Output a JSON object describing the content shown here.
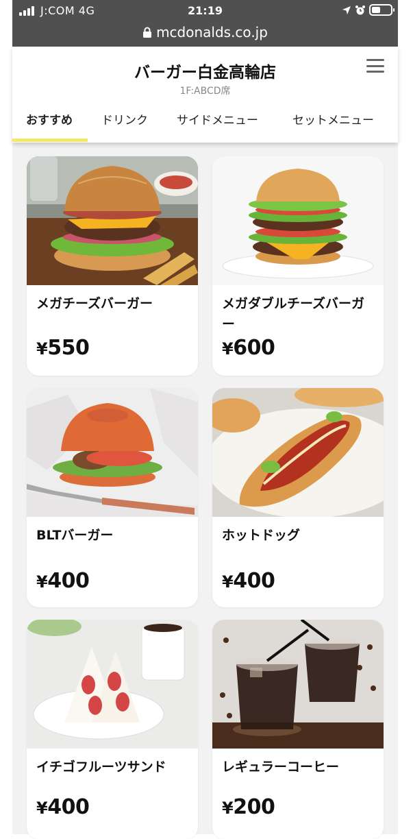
{
  "status_bar": {
    "carrier": "J:COM  4G",
    "time": "21:19"
  },
  "browser": {
    "url": "mcdonalds.co.jp"
  },
  "header": {
    "shop_name": "バーガー白金高輪店",
    "seat": "1F:ABCD席",
    "menu_icon": "hamburger-menu-icon"
  },
  "tabs": [
    {
      "label": "おすすめ",
      "active": true
    },
    {
      "label": "ドリンク",
      "active": false
    },
    {
      "label": "サイドメニュー",
      "active": false
    },
    {
      "label": "セットメニュー",
      "active": false
    }
  ],
  "products": [
    {
      "name": "メガチーズバーガー",
      "currency": "¥",
      "price": "550",
      "image": "cheeseburger-photo"
    },
    {
      "name": "メガダブルチーズバーガー",
      "currency": "¥",
      "price": "600",
      "image": "double-cheeseburger-photo"
    },
    {
      "name": "BLTバーガー",
      "currency": "¥",
      "price": "400",
      "image": "blt-burger-photo"
    },
    {
      "name": "ホットドッグ",
      "currency": "¥",
      "price": "400",
      "image": "hotdog-photo"
    },
    {
      "name": "イチゴフルーツサンド",
      "currency": "¥",
      "price": "400",
      "image": "strawberry-sandwich-photo"
    },
    {
      "name": "レギュラーコーヒー",
      "currency": "¥",
      "price": "200",
      "image": "iced-coffee-photo"
    }
  ],
  "colors": {
    "status_bar": "#505050",
    "tab_underline": "#f3e86a",
    "page_background": "#f2f2f2"
  }
}
